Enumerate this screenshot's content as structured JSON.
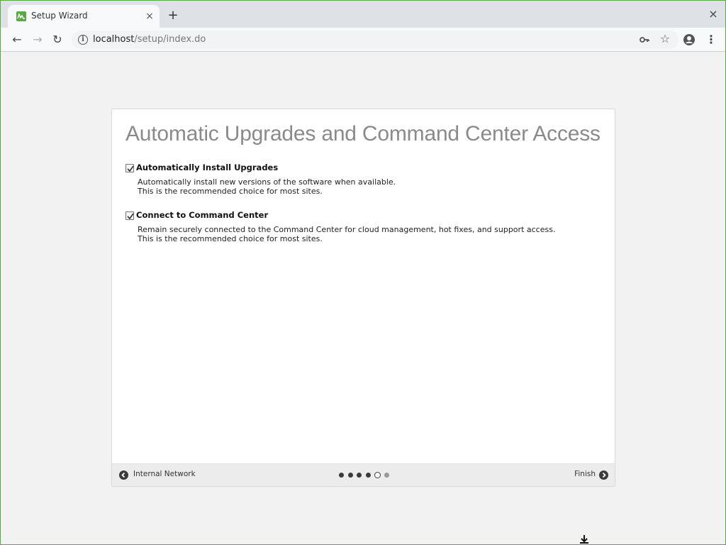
{
  "browser": {
    "tab_title": "Setup Wizard",
    "tab_close": "×",
    "new_tab": "+",
    "window_close": "×",
    "url_host": "localhost",
    "url_path": "/setup/index.do",
    "menu_glyph": "⋮",
    "star_glyph": "☆",
    "back_glyph": "←",
    "forward_glyph": "→",
    "reload_glyph": "↻",
    "info_glyph": "i"
  },
  "wizard": {
    "title": "Automatic Upgrades and Command Center Access",
    "options": [
      {
        "label": "Automatically Install Upgrades",
        "checked": true,
        "desc_line1": "Automatically install new versions of the software when available.",
        "desc_line2": "This is the recommended choice for most sites."
      },
      {
        "label": "Connect to Command Center",
        "checked": true,
        "desc_line1": "Remain securely connected to the Command Center for cloud management, hot fixes, and support access.",
        "desc_line2": "This is the recommended choice for most sites."
      }
    ],
    "footer": {
      "back_label": "Internal Network",
      "next_label": "Finish",
      "total_steps": 6,
      "current_step": 5
    }
  },
  "colors": {
    "brand_green": "#5aa845",
    "title_gray": "#8a8a8a"
  }
}
